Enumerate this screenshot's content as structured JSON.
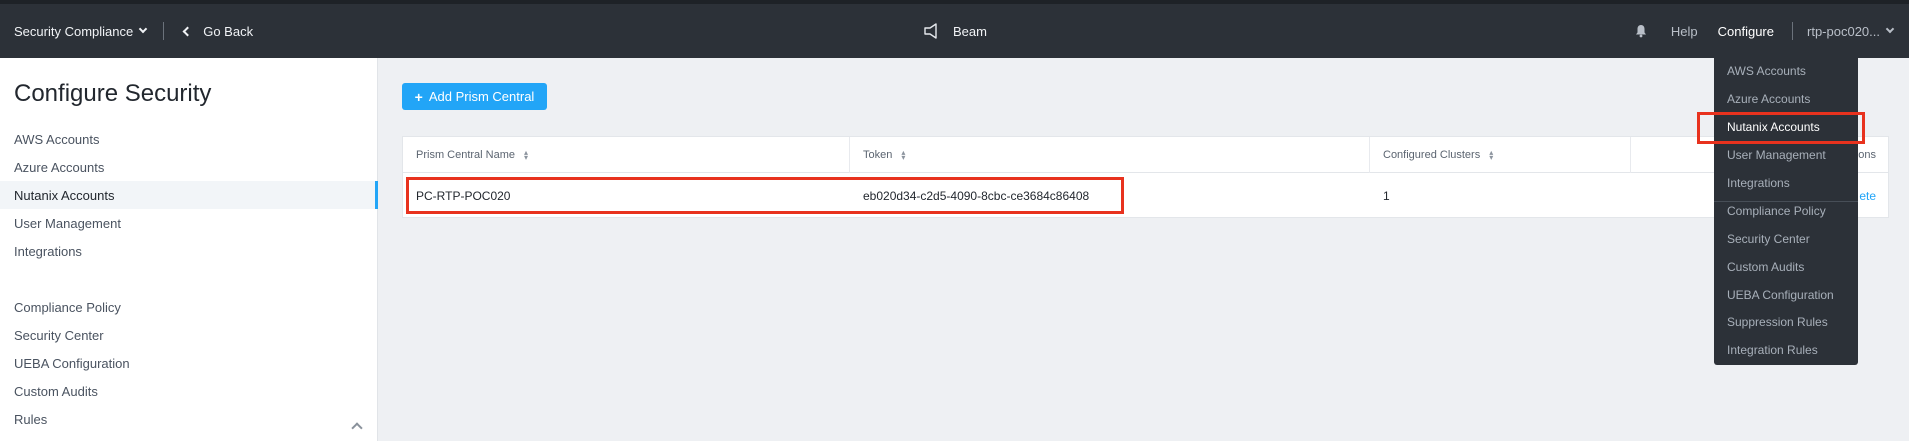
{
  "header": {
    "product": "Security Compliance",
    "go_back": "Go Back",
    "app_name": "Beam",
    "help": "Help",
    "configure": "Configure",
    "user": "rtp-poc020..."
  },
  "sidebar": {
    "title": "Configure Security",
    "items": [
      {
        "label": "AWS Accounts"
      },
      {
        "label": "Azure Accounts"
      },
      {
        "label": "Nutanix Accounts"
      },
      {
        "label": "User Management"
      },
      {
        "label": "Integrations"
      },
      {
        "label": "Compliance Policy"
      },
      {
        "label": "Security Center"
      },
      {
        "label": "UEBA Configuration"
      },
      {
        "label": "Custom Audits"
      },
      {
        "label": "Rules"
      }
    ],
    "active_item": "Nutanix Accounts"
  },
  "main": {
    "add_button": "Add Prism Central",
    "table": {
      "columns": [
        "Prism Central Name",
        "Token",
        "Configured Clusters",
        "ons"
      ],
      "rows": [
        {
          "name": "PC-RTP-POC020",
          "token": "eb020d34-c2d5-4090-8cbc-ce3684c86408",
          "clusters": "1",
          "action": "ete"
        }
      ]
    }
  },
  "configure_menu": {
    "items": [
      {
        "label": "AWS Accounts"
      },
      {
        "label": "Azure Accounts"
      },
      {
        "label": "Nutanix Accounts"
      },
      {
        "label": "User Management"
      },
      {
        "label": "Integrations"
      },
      {
        "label": "Compliance Policy"
      },
      {
        "label": "Security Center"
      },
      {
        "label": "Custom Audits"
      },
      {
        "label": "UEBA Configuration"
      },
      {
        "label": "Suppression Rules"
      },
      {
        "label": "Integration Rules"
      }
    ],
    "active_item": "Nutanix Accounts"
  },
  "colors": {
    "accent": "#22a5f7",
    "navbar": "#2c3138",
    "highlight": "#e8321e",
    "background": "#eef0f3"
  }
}
